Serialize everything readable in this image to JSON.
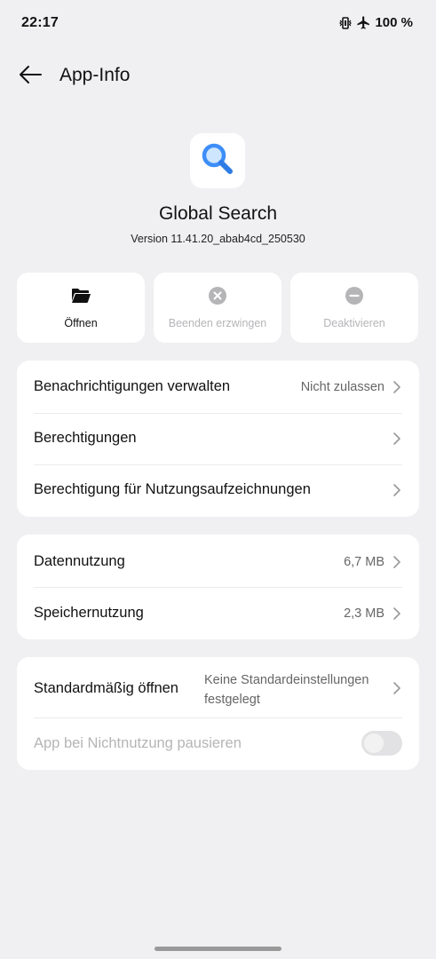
{
  "status_bar": {
    "time": "22:17",
    "battery": "100 %",
    "icons": [
      "vibrate-icon",
      "airplane-mode-icon"
    ]
  },
  "header": {
    "title": "App-Info",
    "back_icon": "arrow-left-icon"
  },
  "app": {
    "name": "Global Search",
    "version": "Version 11.41.20_abab4cd_250530",
    "icon": "magnifier-icon",
    "icon_color": "#3d8ef7"
  },
  "actions": [
    {
      "label": "Öffnen",
      "icon": "folder-icon",
      "enabled": true
    },
    {
      "label": "Beenden erzwingen",
      "icon": "close-circle-icon",
      "enabled": false
    },
    {
      "label": "Deaktivieren",
      "icon": "minus-circle-icon",
      "enabled": false
    }
  ],
  "settings_card_1": [
    {
      "title": "Benachrichtigungen verwalten",
      "value": "Nicht zulassen"
    },
    {
      "title": "Berechtigungen",
      "value": ""
    },
    {
      "title": "Berechtigung für Nutzungsaufzeichnungen",
      "value": ""
    }
  ],
  "settings_card_2": [
    {
      "title": "Datennutzung",
      "value": "6,7 MB"
    },
    {
      "title": "Speichernutzung",
      "value": "2,3 MB"
    }
  ],
  "settings_card_3": {
    "default_open": {
      "title": "Standardmäßig öffnen",
      "value_line1": "Keine Standardeinstellungen",
      "value_line2": "festgelegt"
    },
    "pause_app": {
      "title": "App bei Nichtnutzung pausieren",
      "enabled": false
    }
  },
  "colors": {
    "background": "#f0f0f2",
    "card": "#ffffff",
    "disabled_text": "#b5b5b8",
    "accent": "#3d8ef7"
  }
}
